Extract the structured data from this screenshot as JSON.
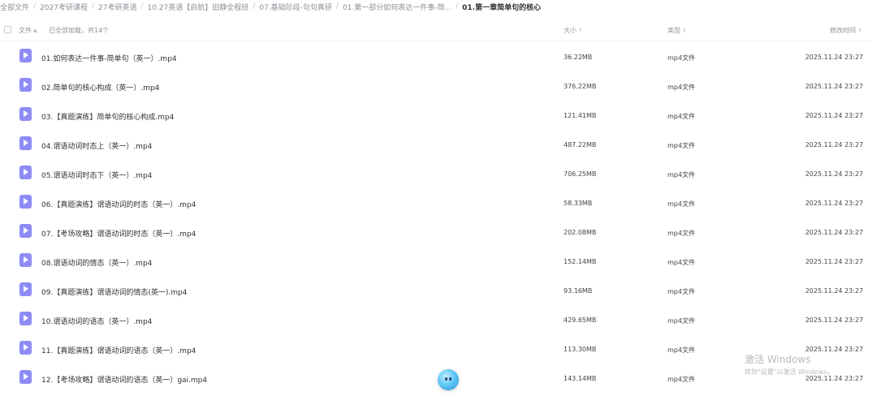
{
  "breadcrumb": [
    "全部文件",
    "2027考研课程",
    "27考研英语",
    "10.27英语【启航】田静全程班",
    "07.基础阶段-句句真研",
    "01.第一部分如何表达一件事-简...",
    "01.第一章简单句的核心"
  ],
  "header": {
    "name_label": "文件",
    "loaded_text": "已全部加载，共14个",
    "size_label": "大小",
    "type_label": "类型",
    "time_label": "修改时间"
  },
  "files": [
    {
      "name": "01.如何表达一件事-简单句（英一）.mp4",
      "size": "36.22MB",
      "type": "mp4文件",
      "time": "2025.11.24 23:27"
    },
    {
      "name": "02.简单句的核心构成（英一）.mp4",
      "size": "376.22MB",
      "type": "mp4文件",
      "time": "2025.11.24 23:27"
    },
    {
      "name": "03.【真题演练】简单句的核心构成.mp4",
      "size": "121.41MB",
      "type": "mp4文件",
      "time": "2025.11.24 23:27"
    },
    {
      "name": "04.谓语动词时态上（英一）.mp4",
      "size": "487.22MB",
      "type": "mp4文件",
      "time": "2025.11.24 23:27"
    },
    {
      "name": "05.谓语动词时态下（英一）.mp4",
      "size": "706.25MB",
      "type": "mp4文件",
      "time": "2025.11.24 23:27"
    },
    {
      "name": "06.【真题演练】谓语动词的时态（英一）.mp4",
      "size": "58.33MB",
      "type": "mp4文件",
      "time": "2025.11.24 23:27"
    },
    {
      "name": "07.【考场攻略】谓语动词的时态（英一）.mp4",
      "size": "202.08MB",
      "type": "mp4文件",
      "time": "2025.11.24 23:27"
    },
    {
      "name": "08.谓语动词的情态（英一）.mp4",
      "size": "152.14MB",
      "type": "mp4文件",
      "time": "2025.11.24 23:27"
    },
    {
      "name": "09.【真题演练】谓语动词的情态(英一).mp4",
      "size": "93.16MB",
      "type": "mp4文件",
      "time": "2025.11.24 23:27"
    },
    {
      "name": "10.谓语动词的语态（英一）.mp4",
      "size": "429.65MB",
      "type": "mp4文件",
      "time": "2025.11.24 23:27"
    },
    {
      "name": "11.【真题演练】谓语动词的语态（英一）.mp4",
      "size": "113.30MB",
      "type": "mp4文件",
      "time": "2025.11.24 23:27"
    },
    {
      "name": "12.【考场攻略】谓语动词的语态（英一）gai.mp4",
      "size": "143.14MB",
      "type": "mp4文件",
      "time": "2025.11.24 23:27"
    }
  ],
  "watermark": {
    "line1": "激活 Windows",
    "line2": "转到\"设置\"以激活 Windows。"
  },
  "icons": {
    "file": "video-file-icon",
    "assistant": "assistant-mascot-icon",
    "sort": "sort-icon"
  },
  "colors": {
    "file_icon": "#8d8cf5",
    "current_crumb": "#333333",
    "muted": "#8a8f99"
  }
}
